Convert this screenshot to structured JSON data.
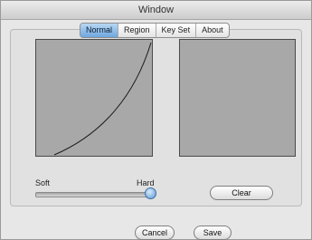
{
  "window": {
    "title": "Window"
  },
  "tabs": [
    {
      "label": "Normal",
      "active": true
    },
    {
      "label": "Region",
      "active": false
    },
    {
      "label": "Key Set",
      "active": false
    },
    {
      "label": "About",
      "active": false
    }
  ],
  "slider": {
    "min_label": "Soft",
    "max_label": "Hard",
    "value": 1.0
  },
  "buttons": {
    "clear": "Clear",
    "cancel": "Cancel",
    "save": "Save"
  },
  "colors": {
    "tab_active": "#7aaee0",
    "pane_fill": "#a8a8a8",
    "curve": "#1a1a1a"
  }
}
